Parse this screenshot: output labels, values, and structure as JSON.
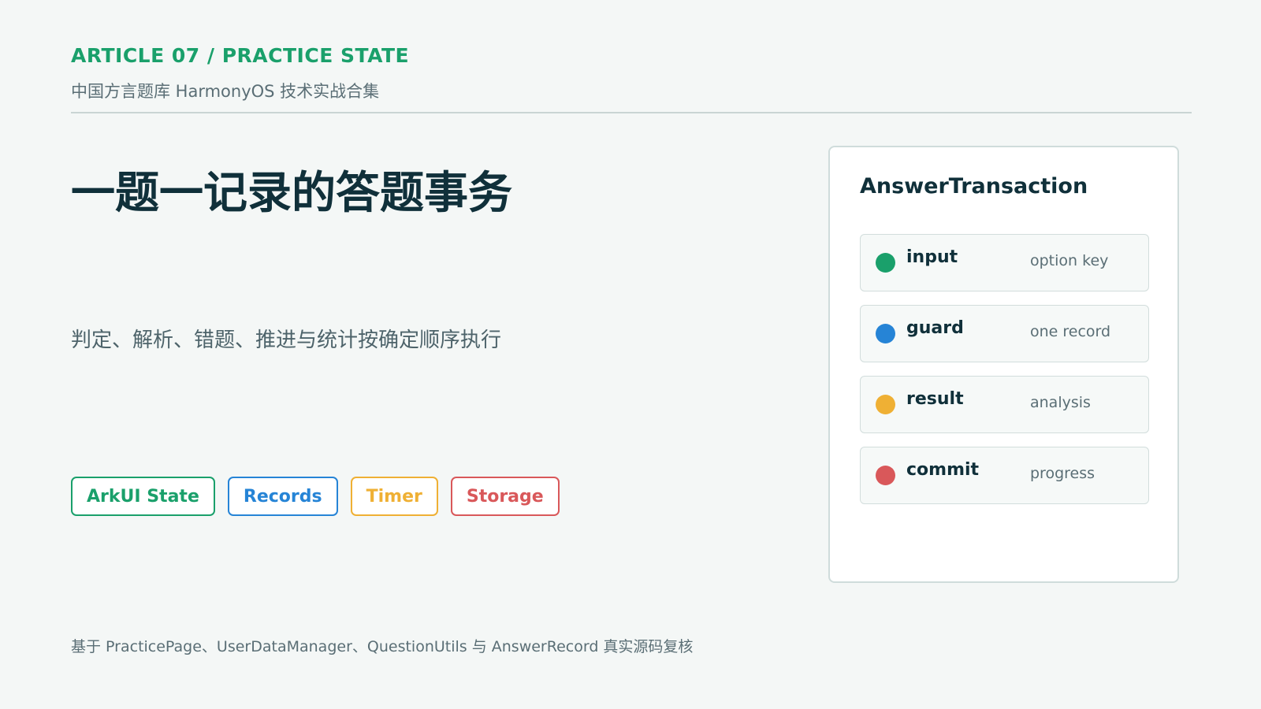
{
  "header": {
    "eyebrow": "ARTICLE 07 / PRACTICE STATE",
    "subtitle": "中国方言题库 HarmonyOS 技术实战合集"
  },
  "main": {
    "title": "一题一记录的答题事务",
    "lead": "判定、解析、错题、推进与统计按确定顺序执行",
    "tags": [
      {
        "label": "ArkUI State",
        "color": "#1aa06b"
      },
      {
        "label": "Records",
        "color": "#2684d6"
      },
      {
        "label": "Timer",
        "color": "#efb034"
      },
      {
        "label": "Storage",
        "color": "#d9585a"
      }
    ]
  },
  "panel": {
    "title": "AnswerTransaction",
    "steps": [
      {
        "name": "input",
        "desc": "option key",
        "color": "#1aa06b"
      },
      {
        "name": "guard",
        "desc": "one record",
        "color": "#2684d6"
      },
      {
        "name": "result",
        "desc": "analysis",
        "color": "#efb034"
      },
      {
        "name": "commit",
        "desc": "progress",
        "color": "#d9585a"
      }
    ]
  },
  "footer": {
    "text": "基于 PracticePage、UserDataManager、QuestionUtils 与 AnswerRecord 真实源码复核"
  }
}
